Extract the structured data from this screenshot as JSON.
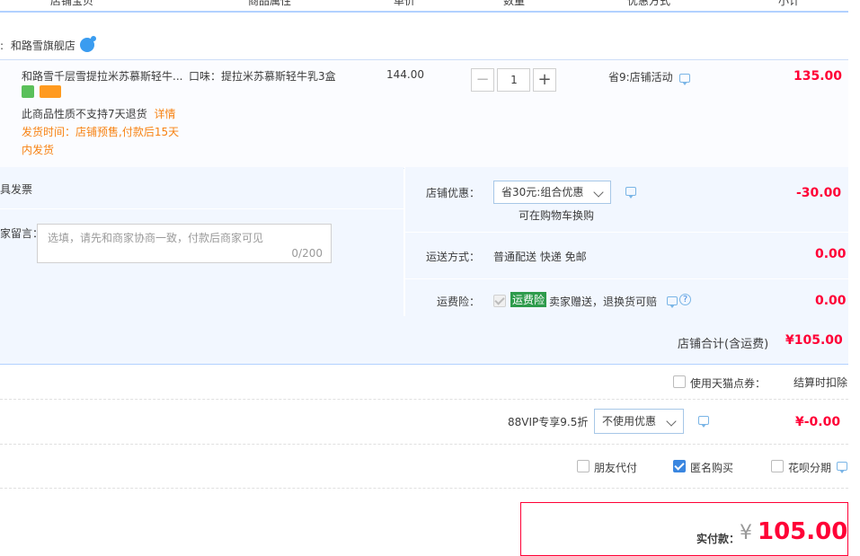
{
  "header": {
    "columns": [
      "店铺宝贝",
      "商品属性",
      "单价",
      "数量",
      "优惠方式",
      "小计"
    ]
  },
  "shop": {
    "prefix": ":",
    "name": "和路雪旗舰店"
  },
  "item": {
    "title": "和路雪千层雪提拉米苏慕斯轻牛...",
    "attribute": "口味：提拉米苏慕斯轻牛乳3盒",
    "unit_price": "144.00",
    "quantity": "1",
    "qty_minus": "−",
    "qty_plus": "+",
    "discount": "省9:店铺活动",
    "subtotal": "135.00",
    "return_notice": "此商品性质不支持7天退货",
    "return_detail_link": "详情",
    "ship_time_line1": "发货时间：店铺预售,付款后15天",
    "ship_time_line2": "内发货"
  },
  "invoice": {
    "label": "具发票"
  },
  "message": {
    "label": "家留言：",
    "placeholder": "选填，请先和商家协商一致，付款后商家可见",
    "counter": "0/200"
  },
  "shop_discount": {
    "label": "店铺优惠：",
    "selected": "省30元:组合优惠",
    "hint": "可在购物车换购",
    "amount": "-30.00"
  },
  "shipping": {
    "label": "运送方式：",
    "value": "普通配送 快递 免邮",
    "amount": "0.00"
  },
  "insurance": {
    "label": "运费险：",
    "badge": "运费险",
    "text": "卖家赠送，退换货可赔",
    "help": "?",
    "amount": "0.00"
  },
  "shop_total": {
    "label": "店铺合计(含运费)",
    "amount": "¥105.00"
  },
  "tmall_points": {
    "label": "使用天猫点券：",
    "note": "结算时扣除"
  },
  "vip": {
    "label": "88VIP专享9.5折",
    "selected": "不使用优惠",
    "amount": "¥-0.00"
  },
  "options": {
    "friend_pay": "朋友代付",
    "anonymous": "匿名购买",
    "huabei": "花呗分期"
  },
  "payment": {
    "label": "实付款：",
    "currency": "¥",
    "amount": "105.00"
  },
  "colors": {
    "accent_red": "#ff0036",
    "orange": "#f78212",
    "border_blue": "#b2d1ff",
    "panel_blue": "#f2f7ff"
  }
}
